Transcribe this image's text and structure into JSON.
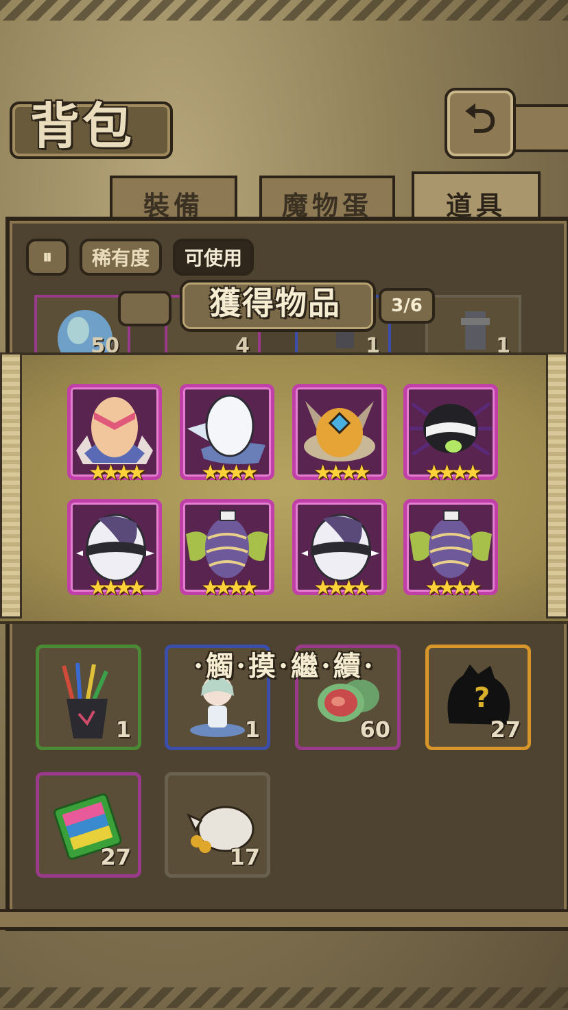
{
  "header": {
    "title": "背包",
    "back_icon": "return-icon"
  },
  "tabs": [
    {
      "label": "裝備",
      "active": false
    },
    {
      "label": "魔物蛋",
      "active": false
    },
    {
      "label": "道具",
      "active": true
    }
  ],
  "filters": [
    {
      "icon": "sort-toggle-icon",
      "label": ""
    },
    {
      "label": "稀有度",
      "active": false
    },
    {
      "label": "可使用",
      "active": true
    }
  ],
  "background_row_counts": [
    "50",
    "4",
    "1",
    "1"
  ],
  "popup": {
    "title": "獲得物品",
    "counter": "3/6",
    "rewards": [
      {
        "name": "feather-nest-egg-icon",
        "stars": "★★★★"
      },
      {
        "name": "winged-white-egg-icon",
        "stars": "★★★★"
      },
      {
        "name": "horned-fluffy-egg-icon",
        "stars": "★★★★"
      },
      {
        "name": "spider-egg-icon",
        "stars": "★★★★"
      },
      {
        "name": "spiked-collar-egg-icon",
        "stars": "★★★★"
      },
      {
        "name": "moth-wing-egg-icon",
        "stars": "★★★★"
      },
      {
        "name": "spiked-collar-egg-icon",
        "stars": "★★★★"
      },
      {
        "name": "moth-wing-egg-icon",
        "stars": "★★★★"
      }
    ],
    "touch_to_continue": "·觸·摸·繼·續·"
  },
  "items": [
    {
      "name": "brush-holder-icon",
      "count": "1",
      "frame": "#4a8a34"
    },
    {
      "name": "girl-figure-icon",
      "count": "1",
      "frame": "#3a4eaa"
    },
    {
      "name": "meat-slab-icon",
      "count": "60",
      "frame": "#9a3a8a"
    },
    {
      "name": "mystery-monster-icon",
      "count": "27",
      "frame": "#d8962a"
    },
    {
      "name": "color-block-book-icon",
      "count": "27",
      "frame": "#9a3a8a"
    },
    {
      "name": "coin-sack-icon",
      "count": "17",
      "frame": "#6a6050"
    }
  ],
  "colors": {
    "epic_frame": "#c040a8",
    "star": "#ffd23a",
    "panel": "#4e4330"
  }
}
